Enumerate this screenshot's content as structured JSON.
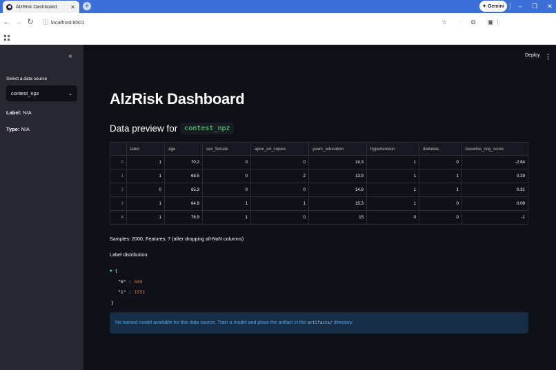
{
  "browser": {
    "tab_title": "AlzRisk Dashboard",
    "tab_close": "✕",
    "new_tab": "+",
    "gemini_label": "Gemini",
    "url": "localhost:8501",
    "window_controls": {
      "minimize": "–",
      "restore": "❐",
      "close": "✕"
    }
  },
  "sidebar": {
    "collapse_glyph": "«",
    "data_source_label": "Select a data source",
    "data_source_value": "contest_npz",
    "label_key": "Label:",
    "label_value": "N/A",
    "type_key": "Type:",
    "type_value": "N/A"
  },
  "header": {
    "deploy_label": "Deploy",
    "menu_glyph": "⋮"
  },
  "main": {
    "title": "AlzRisk Dashboard",
    "preview_prefix": "Data preview for",
    "preview_source": "contest_npz",
    "table": {
      "columns": [
        "",
        "label",
        "age",
        "sex_female",
        "apoe_e4_copies",
        "years_education",
        "hypertension",
        "diabetes",
        "baseline_cog_score"
      ],
      "rows": [
        [
          "0",
          "1",
          "70.2",
          "0",
          "0",
          "14.3",
          "1",
          "0",
          "-2.84"
        ],
        [
          "1",
          "1",
          "68.5",
          "0",
          "2",
          "13.9",
          "1",
          "1",
          "0.29"
        ],
        [
          "2",
          "0",
          "65.3",
          "0",
          "0",
          "14.9",
          "1",
          "1",
          "0.31"
        ],
        [
          "3",
          "1",
          "64.9",
          "1",
          "1",
          "15.3",
          "1",
          "0",
          "0.09"
        ],
        [
          "4",
          "1",
          "76.9",
          "1",
          "0",
          "15",
          "0",
          "0",
          "-1"
        ]
      ]
    },
    "samples_text": "Samples: 2000, Features: 7 (after dropping all-NaN columns)",
    "label_distribution_heading": "Label distribution:",
    "json_view": {
      "open_brace": "{",
      "close_brace": "}",
      "entries": [
        {
          "key": "\"0\"",
          "value": "449"
        },
        {
          "key": "\"1\"",
          "value": "1551"
        }
      ]
    },
    "info": {
      "text_before": "No trained model available for this data source. Train a model and place the artifact in the",
      "code": "artifacts/",
      "text_after": "directory."
    }
  }
}
